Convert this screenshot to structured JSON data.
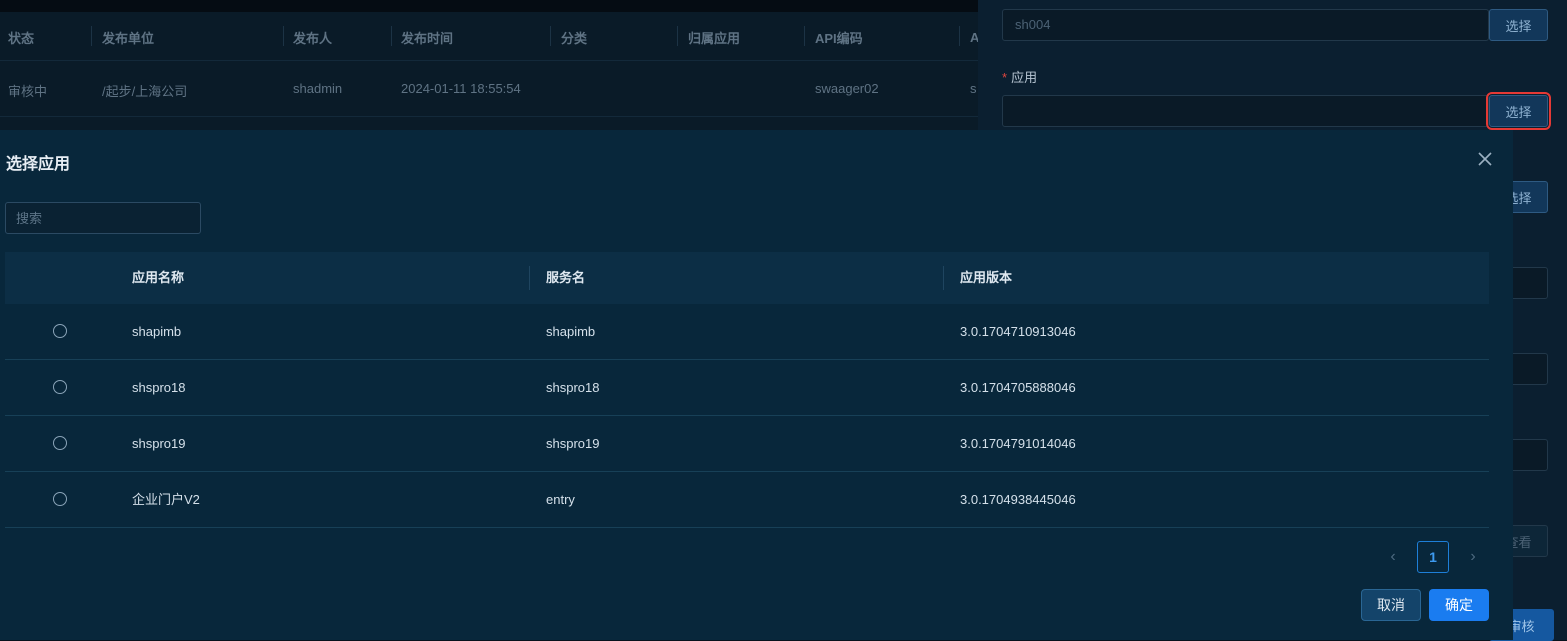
{
  "background": {
    "table": {
      "headers": [
        "状态",
        "发布单位",
        "发布人",
        "发布时间",
        "分类",
        "归属应用",
        "API编码",
        "A"
      ],
      "row": [
        "审核中",
        "/起步/上海公司",
        "shadmin",
        "2024-01-11 18:55:54",
        "",
        "",
        "swaager02",
        "s"
      ]
    },
    "side_panel": {
      "input1_value": "sh004",
      "select_label_1": "选择",
      "app_field_label": "应用",
      "select_label_2": "选择",
      "select_label_3": "选择",
      "partial_label_view": "查看",
      "partial_label_audit": "审核"
    }
  },
  "modal": {
    "title": "选择应用",
    "search": {
      "placeholder": "搜索",
      "value": ""
    },
    "table": {
      "columns": [
        "应用名称",
        "服务名",
        "应用版本"
      ],
      "rows": [
        {
          "app_name": "shapimb",
          "service_name": "shapimb",
          "version": "3.0.1704710913046",
          "selected": false
        },
        {
          "app_name": "shspro18",
          "service_name": "shspro18",
          "version": "3.0.1704705888046",
          "selected": false
        },
        {
          "app_name": "shspro19",
          "service_name": "shspro19",
          "version": "3.0.1704791014046",
          "selected": false
        },
        {
          "app_name": "企业门户V2",
          "service_name": "entry",
          "version": "3.0.1704938445046",
          "selected": false
        }
      ]
    },
    "pagination": {
      "current_page": "1",
      "prev_icon": "chevron-left-icon",
      "next_icon": "chevron-right-icon"
    },
    "buttons": {
      "cancel": "取消",
      "confirm": "确定"
    }
  },
  "colors": {
    "accent": "#1a7cf0",
    "highlight": "#e53935",
    "required": "#e0463f"
  }
}
